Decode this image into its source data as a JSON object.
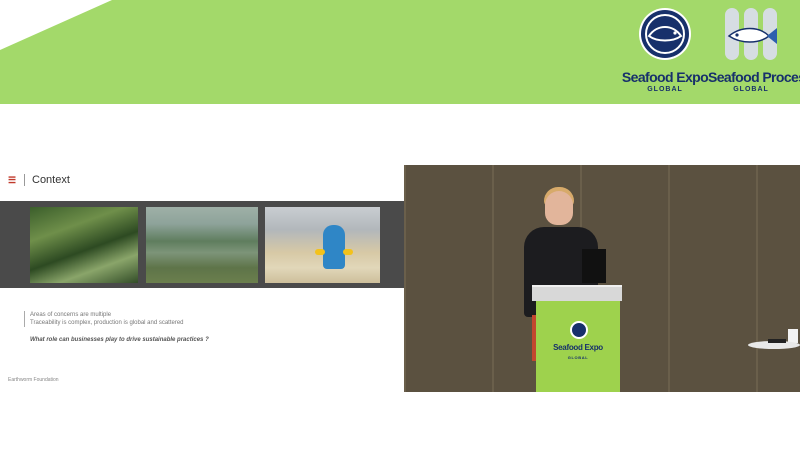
{
  "banner": {
    "colors": {
      "banner": "#a3d96a",
      "logo_navy": "#17306b"
    },
    "logos": [
      {
        "icon": "globe-fish-icon",
        "title": "Seafood Expo",
        "subtitle": "GLOBAL"
      },
      {
        "icon": "fish-icon",
        "title": "Seafood Processing",
        "subtitle": "GLOBAL"
      }
    ]
  },
  "slide": {
    "icon": "brand-mark-icon",
    "title": "Context",
    "photos": [
      {
        "name": "mangrove-photo"
      },
      {
        "name": "aquaculture-ponds-photo"
      },
      {
        "name": "processing-plant-photo"
      }
    ],
    "lines": [
      "Areas of concerns are multiple",
      "Traceability is complex, production is global and scattered"
    ],
    "question": "What role can businesses play to drive sustainable practices ?",
    "footer": "Earthworm Foundation"
  },
  "video": {
    "lectern_logo": {
      "title": "Seafood Expo",
      "subtitle": "GLOBAL"
    }
  }
}
